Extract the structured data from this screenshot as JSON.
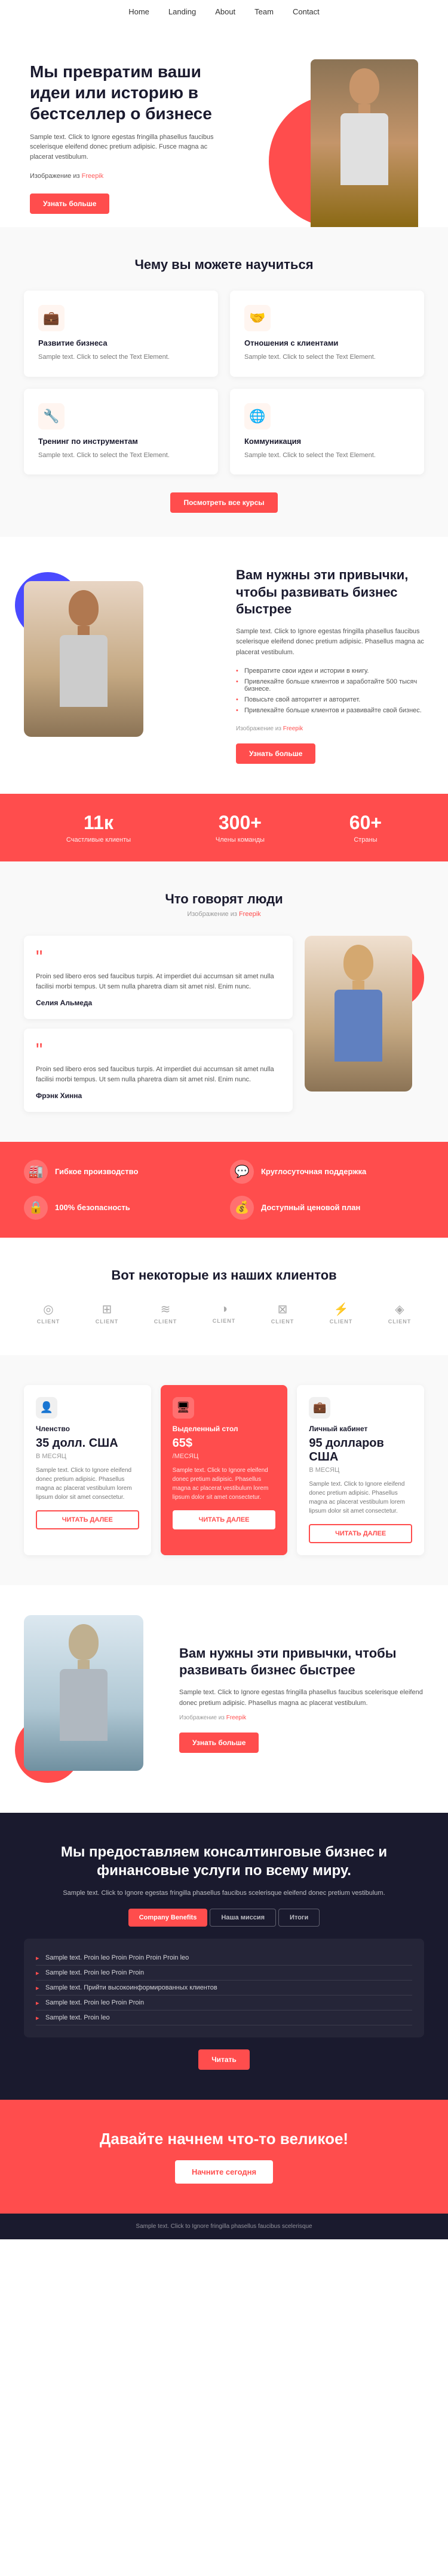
{
  "nav": {
    "links": [
      "Home",
      "Landing",
      "About",
      "Team",
      "Contact"
    ]
  },
  "hero": {
    "heading": "Мы превратим ваши идеи или историю в бестселлер о бизнесе",
    "body": "Sample text. Click to Ignore egestas fringilla phasellus faucibus scelerisque eleifend donec pretium adipisic. Fusce magna ac placerat vestibulum.",
    "image_credit": "Изображение из",
    "image_link": "Freepik",
    "btn_label": "Узнать больше"
  },
  "why_section": {
    "title": "Чему вы можете научиться",
    "cards": [
      {
        "icon": "💼",
        "title": "Развитие бизнеса",
        "text": "Sample text. Click to select the Text Element."
      },
      {
        "icon": "🤝",
        "title": "Отношения с клиентами",
        "text": "Sample text. Click to select the Text Element."
      },
      {
        "icon": "🔧",
        "title": "Тренинг по инструментам",
        "text": "Sample text. Click to select the Text Element."
      },
      {
        "icon": "🌐",
        "title": "Коммуникация",
        "text": "Sample text. Click to select the Text Element."
      }
    ],
    "btn_label": "Посмотреть все курсы"
  },
  "habits_section": {
    "heading": "Вам нужны эти привычки, чтобы развивать бизнес быстрее",
    "body": "Sample text. Click to Ignore egestas fringilla phasellus faucibus scelerisque eleifend donec pretium adipisic. Phasellus magna ac placerat vestibulum.",
    "list": [
      "Превратите свои идеи и истории в книгу.",
      "Привлекайте больше клиентов и заработайте 500 тысяч бизнесе.",
      "Повысьте свой авторитет и авторитет.",
      "Привлекайте больше клиентов и развивайте свой бизнес."
    ],
    "image_credit": "Изображение из",
    "image_link": "Freepik",
    "btn_label": "Узнать больше"
  },
  "stats": [
    {
      "number": "11к",
      "label": "Счастливые клиенты"
    },
    {
      "number": "300+",
      "label": "Члены команды"
    },
    {
      "number": "60+",
      "label": "Страны"
    }
  ],
  "testimonials": {
    "title": "Что говорят люди",
    "image_credit": "Изображение из",
    "image_link": "Freepik",
    "items": [
      {
        "text": "Proin sed libero eros sed faucibus turpis. At imperdiet dui accumsan sit amet nulla facilisi morbi tempus. Ut sem nulla pharetra diam sit amet nisl. Enim nunc.",
        "author": "Селия Альмеда"
      },
      {
        "text": "Proin sed libero eros sed faucibus turpis. At imperdiet dui accumsan sit amet nulla facilisi morbi tempus. Ut sem nulla pharetra diam sit amet nisl. Enim nunc.",
        "author": "Фрэнк Хинна"
      }
    ]
  },
  "features": [
    {
      "icon": "🏭",
      "title": "Гибкое производство",
      "desc": ""
    },
    {
      "icon": "💬",
      "title": "Круглосуточная поддержка",
      "desc": ""
    },
    {
      "icon": "🔒",
      "title": "100% безопасность",
      "desc": ""
    },
    {
      "icon": "💰",
      "title": "Доступный ценовой план",
      "desc": ""
    }
  ],
  "clients": {
    "title": "Вот некоторые из наших клиентов",
    "logos": [
      {
        "icon": "◎",
        "name": "Client"
      },
      {
        "icon": "⊞",
        "name": "Client"
      },
      {
        "icon": "≋",
        "name": "Client"
      },
      {
        "icon": "◑",
        "name": "Client"
      },
      {
        "icon": "⊠",
        "name": "Client"
      },
      {
        "icon": "⚡",
        "name": "Client"
      },
      {
        "icon": "◈",
        "name": "Client"
      }
    ]
  },
  "pricing": {
    "cards": [
      {
        "icon": "👤",
        "title": "Членство",
        "price": "35 долл. США",
        "period": "В МЕСЯЦ",
        "desc": "Sample text. Click to Ignore eleifend donec pretium adipisic. Phasellus magna ac placerat vestibulum lorem lipsum dolor sit amet consectetur.",
        "btn": "ЧИТАТЬ ДАЛЕЕ",
        "featured": false
      },
      {
        "icon": "🖥",
        "title": "Выделенный стол",
        "price": "65$",
        "period": "/МЕСЯЦ",
        "desc": "Sample text. Click to Ignore eleifend donec pretium adipisic. Phasellus magna ac placerat vestibulum lorem lipsum dolor sit amet consectetur.",
        "btn": "ЧИТАТЬ ДАЛЕЕ",
        "featured": true
      },
      {
        "icon": "💼",
        "title": "Личный кабинет",
        "price": "95 долларов США",
        "period": "В МЕСЯЦ",
        "desc": "Sample text. Click to Ignore eleifend donec pretium adipisic. Phasellus magna ac placerat vestibulum lorem lipsum dolor sit amet consectetur.",
        "btn": "ЧИТАТЬ ДАЛЕЕ",
        "featured": false
      }
    ]
  },
  "habits2_section": {
    "heading": "Вам нужны эти привычки, чтобы развивать бизнес быстрее",
    "body": "Sample text. Click to Ignore egestas fringilla phasellus faucibus scelerisque eleifend donec pretium adipisic. Phasellus magna ac placerat vestibulum.",
    "image_credit": "Изображение из",
    "image_link": "Freepik",
    "btn_label": "Узнать больше"
  },
  "consulting": {
    "heading": "Мы предоставляем консалтинговые бизнес и финансовые услуги по всему миру.",
    "desc": "Sample text. Click to Ignore egestas fringilla phasellus faucibus scelerisque eleifend donec pretium vestibulum.",
    "tabs": [
      "Company Benefits",
      "Наша миссия",
      "Итоги"
    ],
    "active_tab": 0,
    "list_items": [
      "Sample text. Proin leo Proin Proin Proin Proin leo",
      "Sample text. Proin leo Proin Proin",
      "Sample text. Прийти высокоинформированных клиентов",
      "Sample text. Proin leo Proin Proin",
      "Sample text. Proin leo"
    ],
    "btn_label": "Читать"
  },
  "cta": {
    "heading": "Давайте начнем что-то великое!",
    "btn_label": "Начните сегодня"
  },
  "footer": {
    "text": "Sample text. Click to Ignore fringilla phasellus faucibus scelerisque"
  }
}
